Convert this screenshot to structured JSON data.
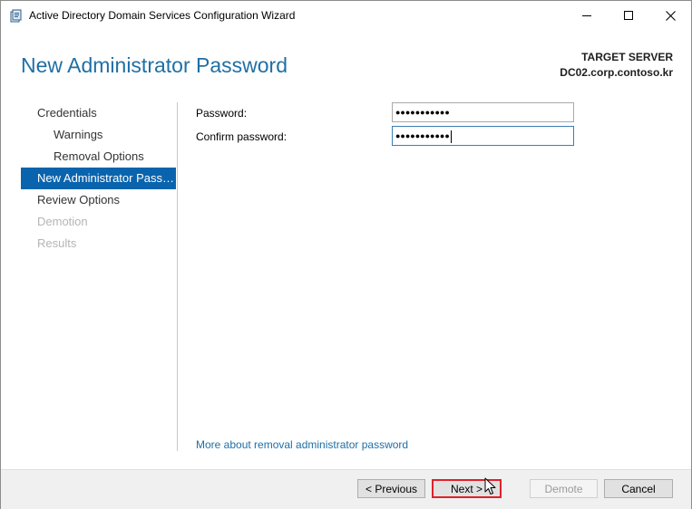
{
  "window": {
    "title": "Active Directory Domain Services Configuration Wizard"
  },
  "header": {
    "title": "New Administrator Password",
    "target_label": "TARGET SERVER",
    "target_name": "DC02.corp.contoso.kr"
  },
  "nav": {
    "items": [
      {
        "label": "Credentials",
        "state": "normal"
      },
      {
        "label": "Warnings",
        "state": "normal"
      },
      {
        "label": "Removal Options",
        "state": "normal"
      },
      {
        "label": "New Administrator Passw...",
        "state": "active"
      },
      {
        "label": "Review Options",
        "state": "normal"
      },
      {
        "label": "Demotion",
        "state": "disabled"
      },
      {
        "label": "Results",
        "state": "disabled"
      }
    ]
  },
  "form": {
    "password_label": "Password:",
    "password_value": "●●●●●●●●●●●",
    "confirm_label": "Confirm password:",
    "confirm_value": "●●●●●●●●●●●"
  },
  "more_link": "More about removal administrator password",
  "footer": {
    "previous_label": "< Previous",
    "next_label": "Next >",
    "demote_label": "Demote",
    "cancel_label": "Cancel"
  },
  "colors": {
    "accent": "#1f6fa5",
    "nav_active": "#0a64ad",
    "highlight_border": "#e0202a"
  }
}
